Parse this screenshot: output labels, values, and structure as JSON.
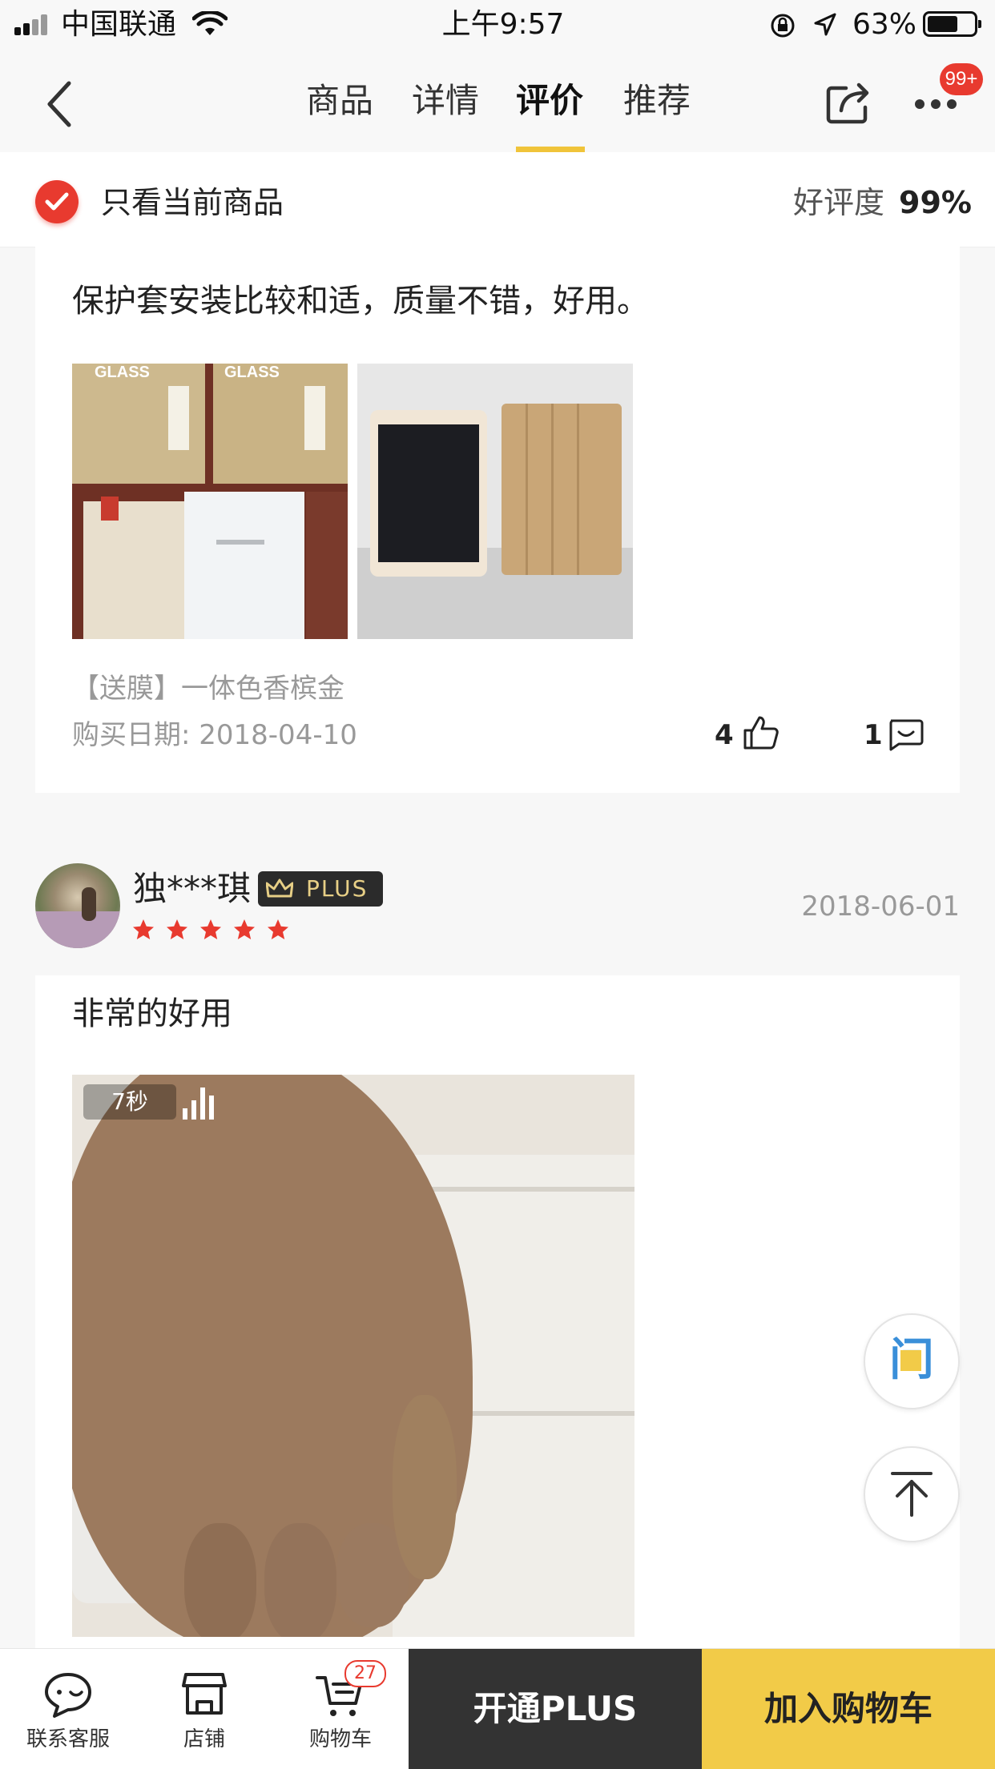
{
  "status_bar": {
    "carrier": "中国联通",
    "time": "上午9:57",
    "battery": "63%"
  },
  "nav": {
    "tabs": [
      "商品",
      "详情",
      "评价",
      "推荐"
    ],
    "active_tab": "评价",
    "badge": "99+"
  },
  "filter": {
    "label": "只看当前商品",
    "rating_label": "好评度",
    "rating_value": "99%"
  },
  "reviews": [
    {
      "text": "保护套安装比较和适，质量不错，好用。",
      "variant": "【送膜】一体色香槟金",
      "purchase_date": "购买日期: 2018-04-10",
      "likes": "4",
      "comments": "1"
    },
    {
      "user": "独***琪",
      "plus": "PLUS",
      "date": "2018-06-01",
      "stars": 5,
      "text": "非常的好用",
      "video_duration": "7秒"
    }
  ],
  "floating": {
    "ask_icon": "问"
  },
  "bottom_bar": {
    "service": "联系客服",
    "shop": "店铺",
    "cart": "购物车",
    "cart_count": "27",
    "plus_button": "开通PLUS",
    "add_to_cart": "加入购物车"
  },
  "colors": {
    "accent_red": "#e83a2f",
    "accent_yellow": "#f2cb48",
    "dark": "#333333"
  }
}
